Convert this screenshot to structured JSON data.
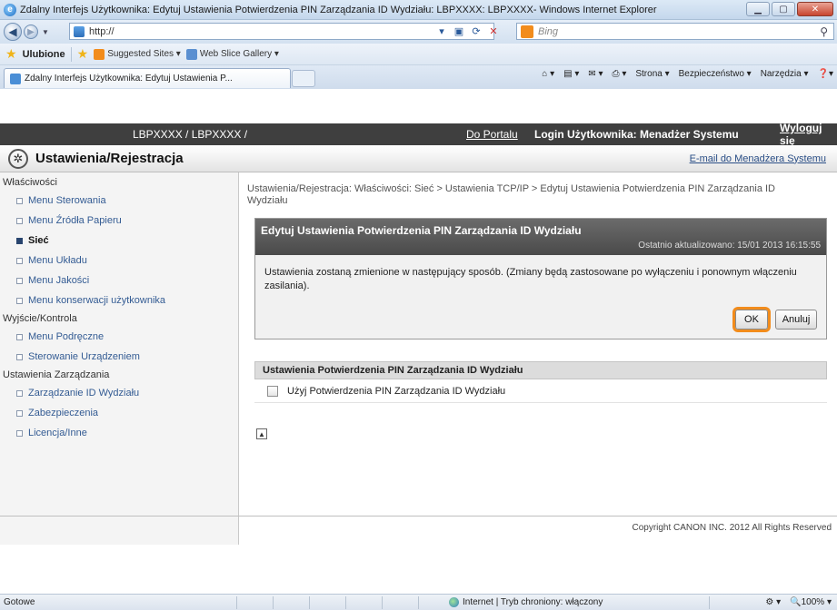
{
  "browser": {
    "window_title": "Zdalny Interfejs Użytkownika: Edytuj Ustawienia Potwierdzenia PIN Zarządzania ID Wydziału: LBPXXXX: LBPXXXX- Windows Internet Explorer",
    "address": "http://",
    "search_placeholder": "Bing",
    "favorites_label": "Ulubione",
    "favorites": [
      "Suggested Sites ▾",
      "Web Slice Gallery ▾"
    ],
    "tab_title": "Zdalny Interfejs Użytkownika: Edytuj Ustawienia P...",
    "commands": [
      "Strona ▾",
      "Bezpieczeństwo ▾",
      "Narzędzia ▾"
    ]
  },
  "topstrip": {
    "device": "LBPXXXX / LBPXXXX /",
    "portal": "Do Portalu",
    "login": "Login Użytkownika: Menadżer Systemu",
    "logout": "Wyloguj się"
  },
  "header": {
    "title": "Ustawienia/Rejestracja",
    "mail_admin": "E-mail do Menadżera Systemu"
  },
  "sidebar": {
    "groups": [
      {
        "label": "Właściwości",
        "items": [
          {
            "label": "Menu Sterowania",
            "active": false
          },
          {
            "label": "Menu Źródła Papieru",
            "active": false
          },
          {
            "label": "Sieć",
            "active": true
          },
          {
            "label": "Menu Układu",
            "active": false
          },
          {
            "label": "Menu Jakości",
            "active": false
          },
          {
            "label": "Menu konserwacji użytkownika",
            "active": false
          }
        ]
      },
      {
        "label": "Wyjście/Kontrola",
        "items": [
          {
            "label": "Menu Podręczne",
            "active": false
          },
          {
            "label": "Sterowanie Urządzeniem",
            "active": false
          }
        ]
      },
      {
        "label": "Ustawienia Zarządzania",
        "items": [
          {
            "label": "Zarządzanie ID Wydziału",
            "active": false
          },
          {
            "label": "Zabezpieczenia",
            "active": false
          },
          {
            "label": "Licencja/Inne",
            "active": false
          }
        ]
      }
    ]
  },
  "content": {
    "breadcrumb": "Ustawienia/Rejestracja: Właściwości: Sieć > Ustawienia TCP/IP > Edytuj Ustawienia Potwierdzenia PIN Zarządzania ID Wydziału",
    "dialog": {
      "title": "Edytuj Ustawienia Potwierdzenia PIN Zarządzania ID Wydziału",
      "updated": "Ostatnio aktualizowano: 15/01 2013 16:15:55",
      "message": "Ustawienia zostaną zmienione w następujący sposób. (Zmiany będą zastosowane po wyłączeniu i ponownym włączeniu zasilania).",
      "ok": "OK",
      "cancel": "Anuluj"
    },
    "section": {
      "title": "Ustawienia Potwierdzenia PIN Zarządzania ID Wydziału",
      "checkbox_label": "Użyj Potwierdzenia PIN Zarządzania ID Wydziału"
    }
  },
  "footer": {
    "copyright": "Copyright CANON INC. 2012 All Rights Reserved"
  },
  "statusbar": {
    "ready": "Gotowe",
    "zone": "Internet | Tryb chroniony: włączony",
    "zoom": "100%"
  },
  "colors": {
    "topstrip_bg": "#3f3f3f",
    "dialog_header_bg": "#555555",
    "ok_highlight": "#f28c1c",
    "link": "#335b93"
  }
}
